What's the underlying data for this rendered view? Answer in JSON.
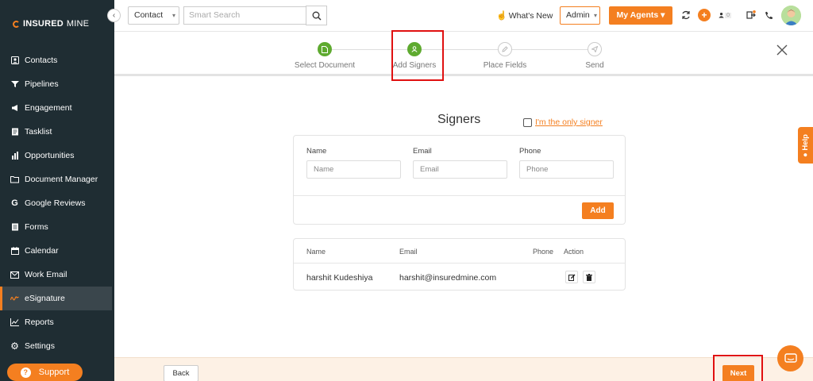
{
  "brand": {
    "name_bold": "INSURED",
    "name_light": "MINE"
  },
  "sidebar": {
    "collapse_glyph": "‹",
    "items": [
      {
        "label": "Contacts",
        "icon": "contacts-icon"
      },
      {
        "label": "Pipelines",
        "icon": "pipelines-icon"
      },
      {
        "label": "Engagement",
        "icon": "megaphone-icon"
      },
      {
        "label": "Tasklist",
        "icon": "tasklist-icon"
      },
      {
        "label": "Opportunities",
        "icon": "bar-chart-icon"
      },
      {
        "label": "Document Manager",
        "icon": "folder-icon"
      },
      {
        "label": "Google Reviews",
        "icon": "google-icon"
      },
      {
        "label": "Forms",
        "icon": "forms-icon"
      },
      {
        "label": "Calendar",
        "icon": "calendar-icon"
      },
      {
        "label": "Work Email",
        "icon": "mail-icon"
      },
      {
        "label": "eSignature",
        "icon": "signature-icon",
        "active": true
      },
      {
        "label": "Reports",
        "icon": "line-chart-icon"
      },
      {
        "label": "Settings",
        "icon": "gear-icon"
      }
    ],
    "support_label": "Support"
  },
  "topbar": {
    "contact_select": "Contact",
    "search_placeholder": "Smart Search",
    "whats_new": "What's New",
    "admin_select": "Admin",
    "my_agents": "My Agents",
    "notification_count": "0"
  },
  "stepper": {
    "steps": [
      {
        "label": "Select Document",
        "state": "done"
      },
      {
        "label": "Add Signers",
        "state": "done"
      },
      {
        "label": "Place Fields",
        "state": "todo"
      },
      {
        "label": "Send",
        "state": "todo"
      }
    ]
  },
  "signers": {
    "title": "Signers",
    "only_signer_label": "I'm the only signer",
    "form": {
      "name_label": "Name",
      "name_placeholder": "Name",
      "email_label": "Email",
      "email_placeholder": "Email",
      "phone_label": "Phone",
      "phone_placeholder": "Phone",
      "add_button": "Add"
    },
    "table": {
      "headers": [
        "Name",
        "Email",
        "Phone",
        "Action"
      ],
      "rows": [
        {
          "name": "harshit Kudeshiya",
          "email": "harshit@insuredmine.com",
          "phone": ""
        }
      ]
    }
  },
  "footer": {
    "back": "Back",
    "next": "Next"
  },
  "help_tab": "Help",
  "colors": {
    "accent": "#f47f20",
    "sidebar_bg": "#1f2d33",
    "step_done": "#5eaa2f",
    "highlight": "#e01010"
  }
}
